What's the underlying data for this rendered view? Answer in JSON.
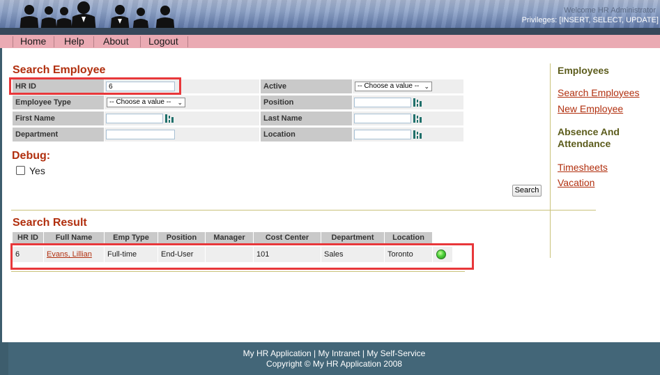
{
  "header": {
    "welcome": "Welcome HR Administrator",
    "privileges": "Privileges: [INSERT, SELECT, UPDATE]"
  },
  "nav": {
    "items": [
      "Home",
      "Help",
      "About",
      "Logout"
    ]
  },
  "search": {
    "title": "Search Employee",
    "fields": {
      "hr_id_label": "HR ID",
      "hr_id_value": "6",
      "active_label": "Active",
      "active_value": "-- Choose a value --",
      "employee_type_label": "Employee Type",
      "employee_type_value": "-- Choose a value --",
      "position_label": "Position",
      "first_name_label": "First Name",
      "last_name_label": "Last Name",
      "department_label": "Department",
      "location_label": "Location"
    },
    "debug_title": "Debug:",
    "debug_option": "Yes",
    "search_button": "Search"
  },
  "results": {
    "title": "Search Result",
    "columns": [
      "HR ID",
      "Full Name",
      "Emp Type",
      "Position",
      "Manager",
      "Cost Center",
      "Department",
      "Location"
    ],
    "rows": [
      {
        "hr_id": "6",
        "full_name": "Evans, Lillian",
        "emp_type": "Full-time",
        "position": "End-User",
        "manager": "",
        "cost_center": "101",
        "department": "Sales",
        "location": "Toronto",
        "status": "active"
      }
    ]
  },
  "sidebar": {
    "employees_heading": "Employees",
    "search_employees": "Search Employees",
    "new_employee": "New Employee",
    "absence_heading_1": "Absence And",
    "absence_heading_2": "Attendance",
    "timesheets": "Timesheets",
    "vacation": "Vacation"
  },
  "footer": {
    "links": "My HR Application | My Intranet | My Self-Service",
    "copyright": "Copyright © My HR Application 2008"
  },
  "colors": {
    "accent": "#b12f0e",
    "nav_bg": "#eaaab3",
    "highlight": "#e8373a",
    "footer_bg": "#436678"
  }
}
